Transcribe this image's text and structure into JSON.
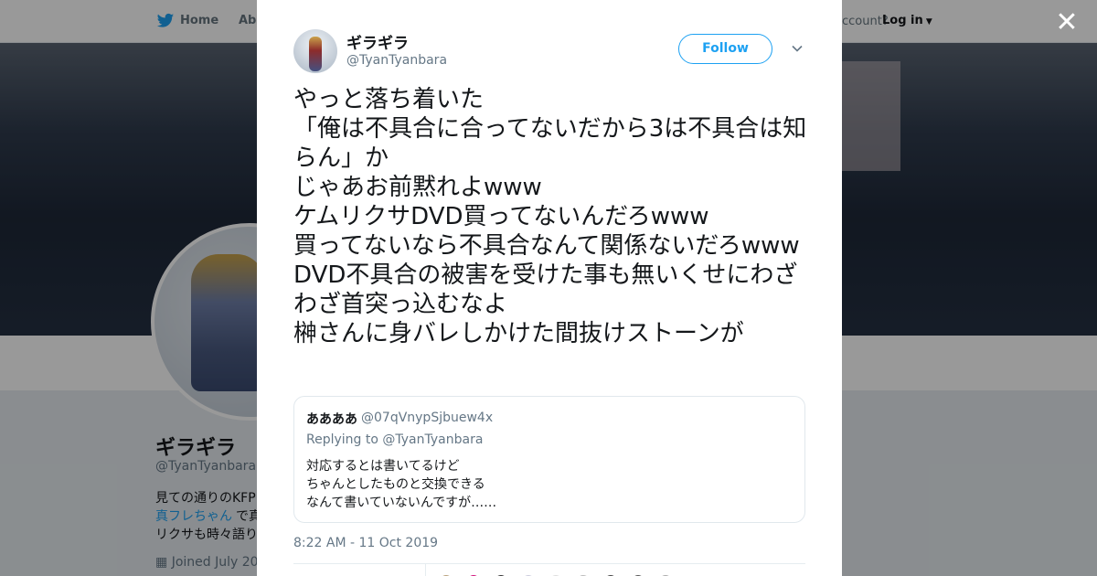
{
  "nav": {
    "home": "Home",
    "about": "Abo",
    "account_prompt": "ccount?",
    "login": "Log in"
  },
  "profile": {
    "name": "ギラギラ",
    "handle": "@TyanTyanbara",
    "bio_line1": "見ての通りのKFP",
    "bio_link": "真フレちゃん",
    "bio_line2_rest": "で真",
    "bio_line3": "リクサも時々語り",
    "joined": "Joined July 20"
  },
  "tweet": {
    "author_name": "ギラギラ",
    "author_handle": "@TyanTyanbara",
    "follow_label": "Follow",
    "text": "やっと落ち着いた\n「俺は不具合に合ってないだから3は不具合は知らん」か\nじゃあお前黙れよwww\nケムリクサDVD買ってないんだろwww\n買ってないなら不具合なんて関係ないだろwww\nDVD不具合の被害を受けた事も無いくせにわざわざ首突っ込むなよ\n榊さんに身バレしかけた間抜けストーンが",
    "timestamp": "8:22 AM - 11 Oct 2019"
  },
  "quoted": {
    "name": "ああああ",
    "handle": "@07qVnypSjbuew4x",
    "reply_prefix": "Replying to",
    "reply_to": "@TyanTyanbara",
    "text": "対応するとは書いてるけど\nちゃんとしたものと交換できる\nなんて書いていないんですが……"
  },
  "colors": {
    "accent": "#1da1f2",
    "text": "#14171a",
    "muted": "#657786"
  },
  "icons": {
    "logo": "twitter-bird-icon",
    "close": "close-icon",
    "caret": "chevron-down-icon"
  }
}
